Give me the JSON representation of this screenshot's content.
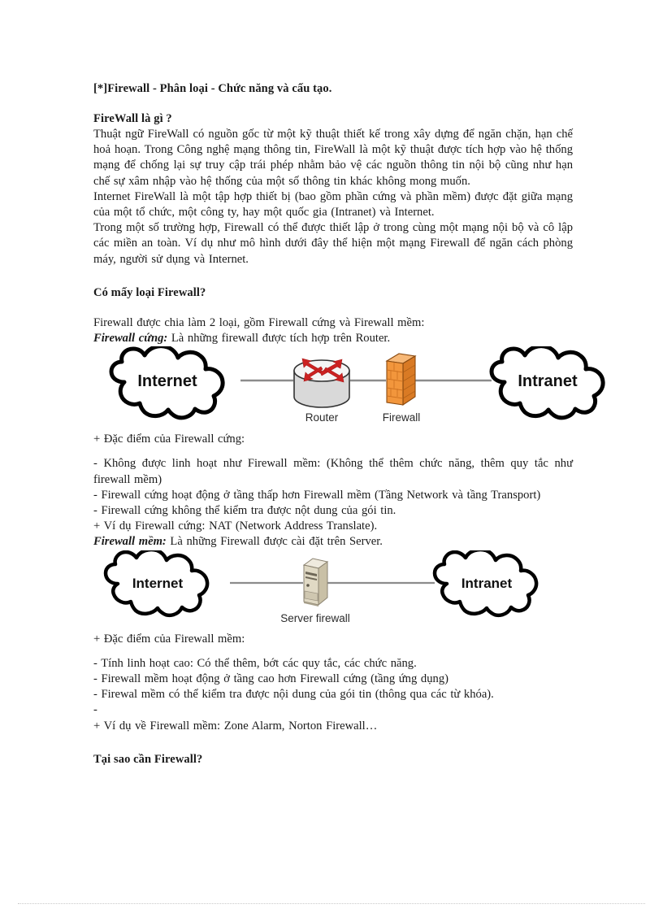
{
  "document": {
    "title": "[*]Firewall  - Phân loại - Chức năng và cấu tạo.",
    "section1_heading": "FireWall là gì ?",
    "section1_p1": "Thuật ngữ FireWall  có nguồn  gốc từ một kỹ thuật  thiết kế trong xây dựng để ngăn chặn, hạn chế hoả hoạn.  Trong Công nghệ mạng thông tin,  FireWall  là một kỹ thuật  được tích hợp vào hệ thống mạng  để chống lại sự truy  cập trái phép nhằm  bảo vệ các nguồn  thông tin nội bộ cũng như hạn chế sự xâm nhập  vào hệ thống  của một số thông tin khác không mong muốn.",
    "section1_p2": "Internet  FireWall  là một tập hợp thiết bị (bao gồm  phần cứng và phần mềm)  được đặt giữa mạng  của một tổ chức, một công ty, hay một quốc gia (Intranet)  và Internet.",
    "section1_p3": "Trong một số trường hợp, Firewall  có thể được thiết lập ở trong cùng một mạng nội bộ và cô lập các miền  an toàn.  Ví dụ như mô hình  dưới đây thể hiện  một mạng Firewall  để ngăn cách phòng máy, người sử dụng và Internet.",
    "section2_heading": "Có mấy loại Firewall?",
    "section2_p1": "Firewall  được chia làm  2 loại, gồm  Firewall  cứng và Firewall  mềm:",
    "hardware_lead": "Firewall cứng:",
    "hardware_lead_rest": " Là những firewall  được tích hợp  trên Router.",
    "hardware_features_heading": "+ Đặc điểm  của Firewall  cứng:",
    "hardware_features": [
      "- Không  được linh  hoạt như Firewall  mềm:  (Không  thể thêm  chức năng,  thêm  quy tắc như firewall  mềm)",
      "- Firewall  cứng hoạt động ở tầng  thấp hơn Firewall  mềm (Tầng  Network và tầng Transport)",
      "- Firewall  cứng không thể kiểm  tra được nột dung  của gói tin.",
      "+ Ví dụ Firewall  cứng:  NAT (Network  Address  Translate)."
    ],
    "software_lead": "Firewall mềm:",
    "software_lead_rest": " Là những  Firewall  được cài đặt trên Server.",
    "software_features_heading": "+ Đặc điểm  của Firewall  mềm:",
    "software_features": [
      "- Tính  linh  hoạt cao: Có thể thêm,  bớt các quy tắc, các chức năng.",
      "- Firewall  mềm  hoạt động ở tầng cao hơn Firewall  cứng (tầng ứng dụng)",
      "- Firewal  mềm  có thể kiểm  tra được nội dung  của gói tin (thông  qua các từ khóa).",
      "-",
      "+ Ví dụ về Firewall  mềm:  Zone  Alarm,  Norton Firewall…"
    ],
    "section3_heading": "Tại sao cần Firewall?"
  },
  "diagram_hardware": {
    "cloud_left_label": "Internet",
    "cloud_right_label": "Intranet",
    "node1_label": "Router",
    "node2_label": "Firewall",
    "colors": {
      "cloud_outline": "#000000",
      "cloud_fill": "#ffffff",
      "link": "#8c8c8c",
      "router_body": "#d9d9d9",
      "router_top": "#f2f2f2",
      "router_arrow": "#cc2222",
      "firewall_front": "#f2963c",
      "firewall_side": "#d97a24",
      "firewall_top": "#f7b877"
    }
  },
  "diagram_software": {
    "cloud_left_label": "Internet",
    "cloud_right_label": "Intranet",
    "node1_label": "Server firewall",
    "colors": {
      "cloud_outline": "#000000",
      "link": "#8c8c8c",
      "server_front": "#e0d9c4",
      "server_side": "#c9c0a6",
      "server_top": "#efeade",
      "server_bezel": "#8a8270"
    }
  }
}
